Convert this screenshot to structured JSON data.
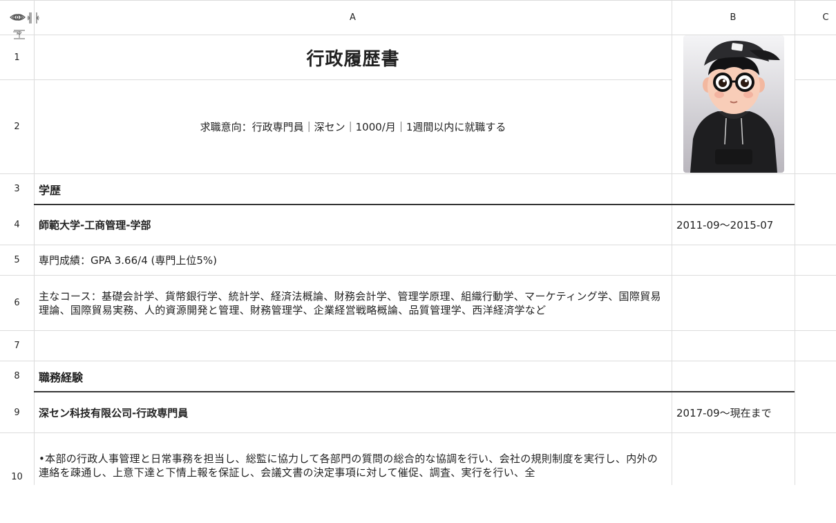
{
  "columns": [
    "A",
    "B",
    "C"
  ],
  "rows": [
    "1",
    "2",
    "3",
    "4",
    "5",
    "6",
    "7",
    "8",
    "9",
    "10"
  ],
  "cells": {
    "title": "行政履歴書",
    "intent": "求職意向：行政専門員｜深セン｜1000/月｜1週間以内に就職する",
    "education_heading": "学歴",
    "school": "師範大学-工商管理-学部",
    "school_dates": "2011-09～2015-07",
    "gpa": "専門成績：GPA 3.66/4 (専門上位5%)",
    "courses": "主なコース：基礎会計学、貨幣銀行学、統計学、経済法概論、財務会計学、管理学原理、組織行動学、マーケティング学、国際貿易理論、国際貿易実務、人的資源開発と管理、財務管理学、企業経営戦略概論、品質管理学、西洋経済学など",
    "experience_heading": "職務経験",
    "company": "深セン科技有限公司-行政専門員",
    "company_dates": "2017-09～現在まで",
    "duties": "•本部の行政人事管理と日常事務を担当し、総監に協力して各部門の質問の総合的な協調を行い、会社の規則制度を実行し、内外の連絡を疎通し、上意下達と下情上報を保証し、会議文書の決定事項に対して催促、調査、実行を行い、全"
  },
  "icons": [
    "eye-icon",
    "collapse-columns-icon",
    "collapse-rows-icon"
  ],
  "colors": {
    "grid": "#dcdcdc",
    "rule": "#333333",
    "text": "#222222"
  }
}
